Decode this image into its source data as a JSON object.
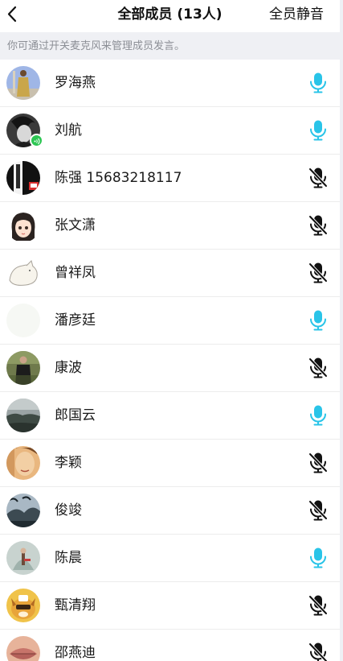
{
  "header": {
    "title": "全部成员 (13人)",
    "mute_all_label": "全员静音"
  },
  "hint": "你可通过开关麦克风来管理成员发言。",
  "colors": {
    "mic_on": "#29c4e8",
    "mic_off": "#111111",
    "speaking_badge": "#2dc653",
    "hint_bar": "#eff0f4"
  },
  "members": [
    {
      "name": "罗海燕",
      "mic": "on",
      "icon": "mic-icon"
    },
    {
      "name": "刘航",
      "mic": "on",
      "icon": "mic-icon",
      "speaking": true
    },
    {
      "name": "陈强 15683218117",
      "mic": "off",
      "icon": "mic-muted-icon"
    },
    {
      "name": "张文潇",
      "mic": "off",
      "icon": "mic-muted-icon"
    },
    {
      "name": "曾祥凤",
      "mic": "off",
      "icon": "mic-muted-icon"
    },
    {
      "name": "潘彦廷",
      "mic": "on",
      "icon": "mic-icon"
    },
    {
      "name": "康波",
      "mic": "off",
      "icon": "mic-muted-icon"
    },
    {
      "name": "郎国云",
      "mic": "on",
      "icon": "mic-icon"
    },
    {
      "name": "李颖",
      "mic": "off",
      "icon": "mic-muted-icon"
    },
    {
      "name": "俊竣",
      "mic": "off",
      "icon": "mic-muted-icon"
    },
    {
      "name": "陈晨",
      "mic": "on",
      "icon": "mic-icon"
    },
    {
      "name": "甄清翔",
      "mic": "off",
      "icon": "mic-muted-icon"
    },
    {
      "name": "邵燕迪",
      "mic": "off",
      "icon": "mic-muted-icon"
    }
  ]
}
